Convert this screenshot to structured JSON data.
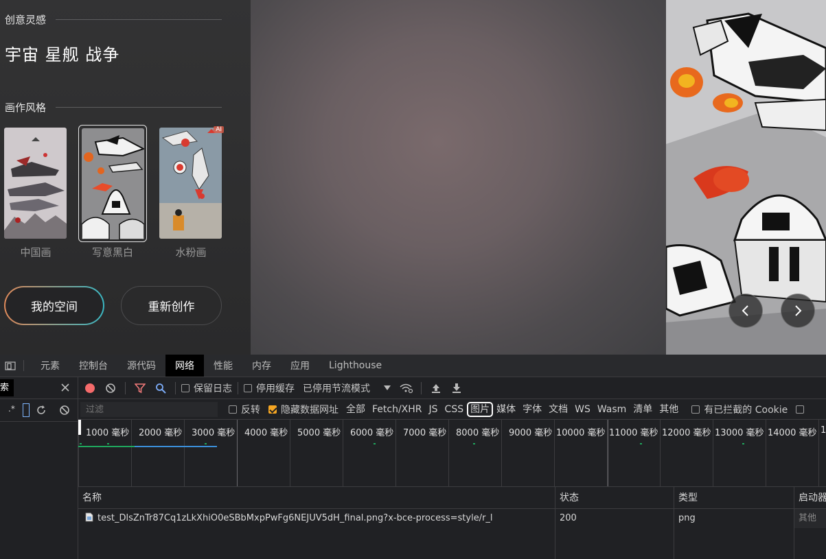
{
  "app": {
    "inspiration_title": "创意灵感",
    "prompt": "宇宙 星舰 战争",
    "style_title": "画作风格",
    "styles": [
      {
        "label": "中国画",
        "selected": false
      },
      {
        "label": "写意黑白",
        "selected": true
      },
      {
        "label": "水粉画",
        "selected": false,
        "badge": "AI"
      }
    ],
    "my_space_label": "我的空间",
    "recreate_label": "重新创作"
  },
  "devtools": {
    "tabs": [
      "元素",
      "控制台",
      "源代码",
      "网络",
      "性能",
      "内存",
      "应用",
      "Lighthouse"
    ],
    "active_tab": "网络",
    "toolbar": {
      "preserve_log": "保留日志",
      "disable_cache": "停用缓存",
      "throttling": "已停用节流模式"
    },
    "filter": {
      "placeholder": "过滤",
      "invert": "反转",
      "hide_data_urls": "隐藏数据网址",
      "types": [
        "全部",
        "Fetch/XHR",
        "JS",
        "CSS",
        "图片",
        "媒体",
        "字体",
        "文档",
        "WS",
        "Wasm",
        "清单",
        "其他"
      ],
      "active_type": "图片",
      "blocked_cookies": "有已拦截的 Cookie"
    },
    "sidebar": {
      "search_text": "索",
      "regex_label": ".*"
    },
    "timeline_ticks": [
      "1000 毫秒",
      "2000 毫秒",
      "3000 毫秒",
      "4000 毫秒",
      "5000 毫秒",
      "6000 毫秒",
      "7000 毫秒",
      "8000 毫秒",
      "9000 毫秒",
      "10000 毫秒",
      "11000 毫秒",
      "12000 毫秒",
      "13000 毫秒",
      "14000 毫秒",
      "1"
    ],
    "table": {
      "columns": [
        "名称",
        "状态",
        "类型",
        "启动器"
      ],
      "rows": [
        {
          "name": "test_DlsZnTr87Cq1zLkXhiO0eSBbMxpPwFg6NEJUV5dH_final.png?x-bce-process=style/r_l",
          "status": "200",
          "type": "png",
          "initiator": "其他"
        }
      ]
    }
  }
}
